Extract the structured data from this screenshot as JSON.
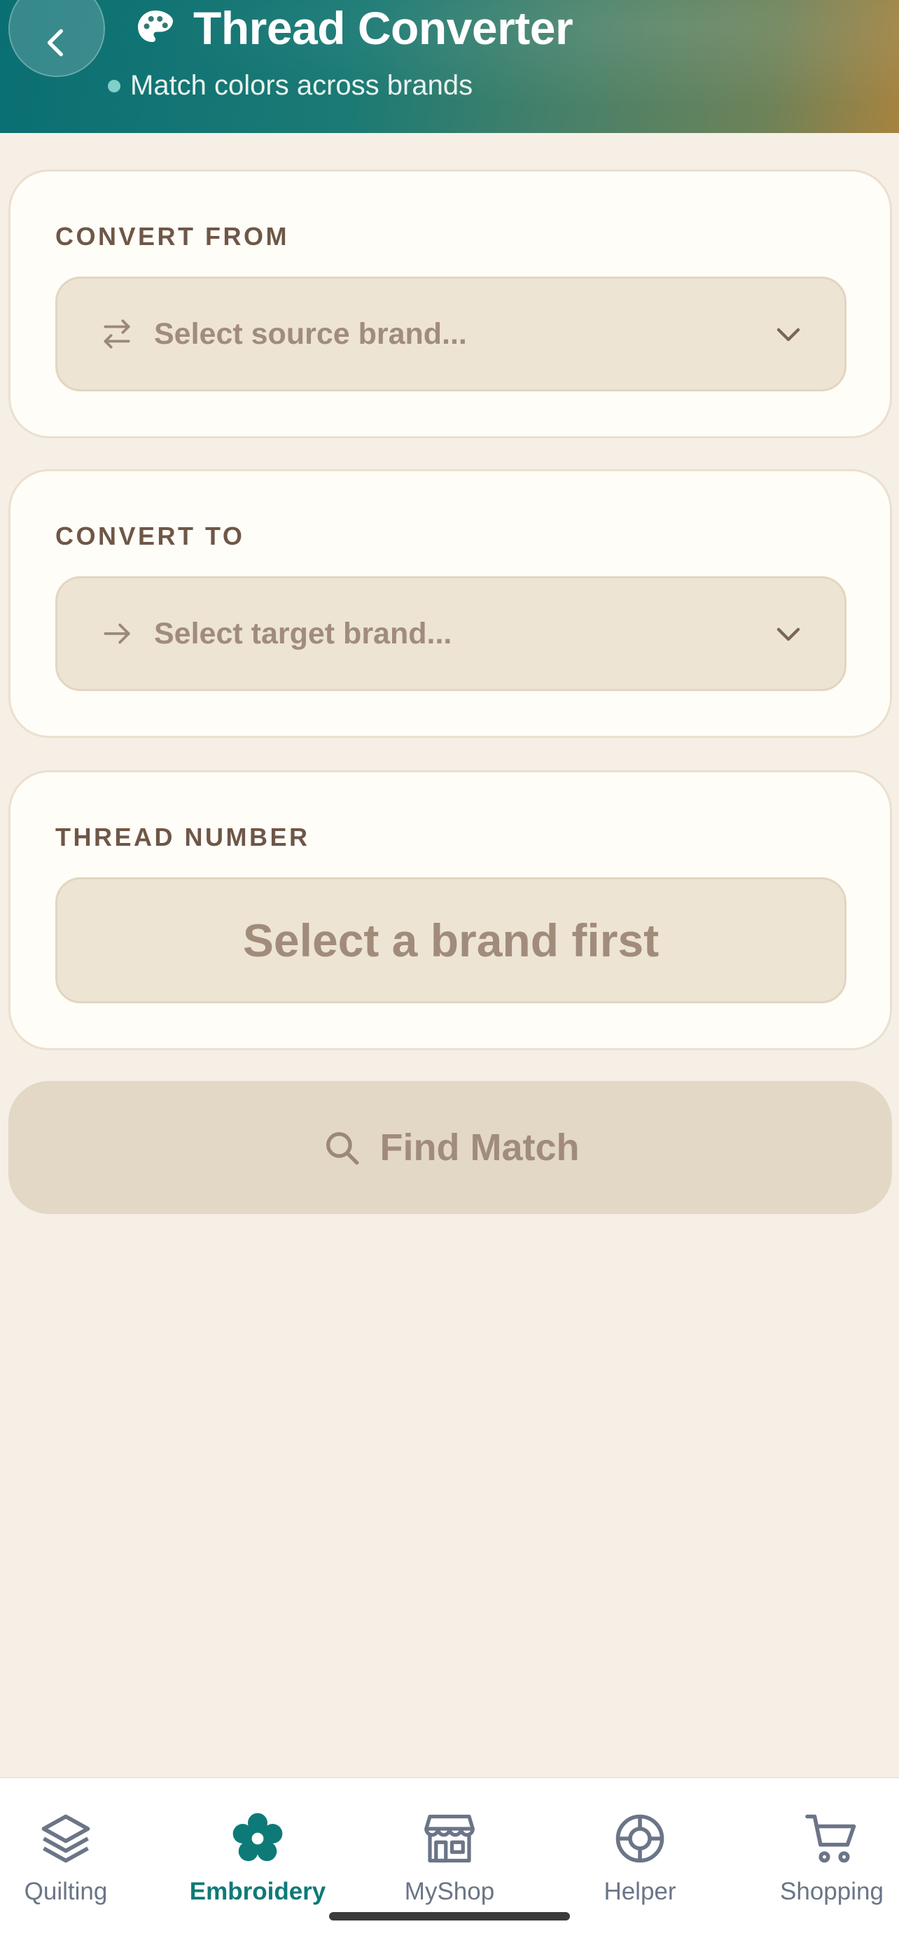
{
  "header": {
    "title": "Thread Converter",
    "subtitle": "Match colors across brands"
  },
  "convert_from": {
    "label": "CONVERT FROM",
    "placeholder": "Select source brand..."
  },
  "convert_to": {
    "label": "CONVERT TO",
    "placeholder": "Select target brand..."
  },
  "thread_number": {
    "label": "THREAD NUMBER",
    "placeholder": "Select a brand first"
  },
  "find_button": {
    "label": "Find Match"
  },
  "nav": {
    "items": [
      {
        "label": "Quilting",
        "icon": "layers-icon",
        "active": false
      },
      {
        "label": "Embroidery",
        "icon": "flower-icon",
        "active": true
      },
      {
        "label": "MyShop",
        "icon": "storefront-icon",
        "active": false
      },
      {
        "label": "Helper",
        "icon": "lifebuoy-icon",
        "active": false
      },
      {
        "label": "Shopping",
        "icon": "cart-icon",
        "active": false
      }
    ]
  },
  "colors": {
    "accent": "#0e7a78",
    "background": "#f6efe5",
    "card": "#fffdf7",
    "field": "#ede4d4",
    "muted_text": "#a18c7c",
    "label_text": "#6e5748"
  }
}
